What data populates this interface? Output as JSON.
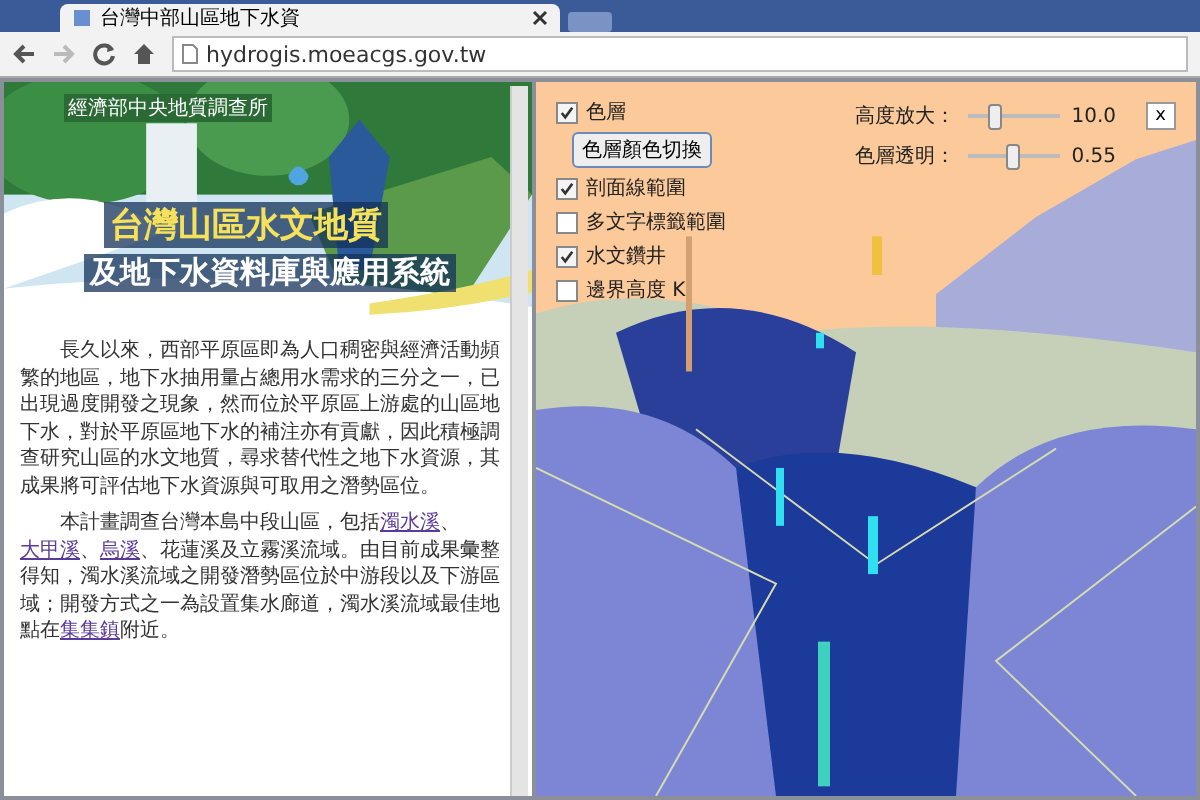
{
  "browser": {
    "tab_title": "台灣中部山區地下水資",
    "address": "hydrogis.moeacgs.gov.tw"
  },
  "header": {
    "agency": "經濟部中央地質調查所",
    "title_line1": "台灣山區水文地質",
    "title_line2": "及地下水資料庫與應用系統"
  },
  "paragraphs": [
    {
      "parts": [
        {
          "text": "長久以來，西部平原區即為人口稠密與經濟活動頻繁的地區，地下水抽用量占總用水需求的三分之一，已出現過度開發之現象，然而位於平原區上游處的山區地下水，對於平原區地下水的補注亦有貢獻，因此積極調查研究山區的水文地質，尋求替代性之地下水資源，其成果將可評估地下水資源與可取用之潛勢區位。",
          "link": false
        }
      ]
    },
    {
      "parts": [
        {
          "text": "本計畫調查台灣本島中段山區，包括",
          "link": false
        },
        {
          "text": "濁水溪",
          "link": true
        },
        {
          "text": "、",
          "link": false
        },
        {
          "text": "大甲溪",
          "link": true
        },
        {
          "text": "、",
          "link": false
        },
        {
          "text": "烏溪",
          "link": true
        },
        {
          "text": "、花蓮溪及立霧溪流域。由目前成果彙整得知，濁水溪流域之開發潛勢區位於中游段以及下游區域；開發方式之一為設置集水廊道，濁水溪流域最佳地點在",
          "link": false
        },
        {
          "text": "集集鎮",
          "link": true
        },
        {
          "text": "附近。",
          "link": false
        }
      ]
    }
  ],
  "controls": [
    {
      "kind": "checkbox",
      "label": "色層",
      "checked": true
    },
    {
      "kind": "button",
      "label": "色層顏色切換"
    },
    {
      "kind": "checkbox",
      "label": "剖面線範圍",
      "checked": true
    },
    {
      "kind": "checkbox",
      "label": "多文字標籤範圍",
      "checked": false
    },
    {
      "kind": "checkbox",
      "label": "水文鑽井",
      "checked": true
    },
    {
      "kind": "checkbox",
      "label": "邊界高度 K",
      "checked": false
    }
  ],
  "sliders": [
    {
      "label": "高度放大：",
      "level": 0.3,
      "reading": "10.0"
    },
    {
      "label": "色層透明：",
      "level": 0.5,
      "reading": "0.55"
    }
  ],
  "close_button": "x"
}
